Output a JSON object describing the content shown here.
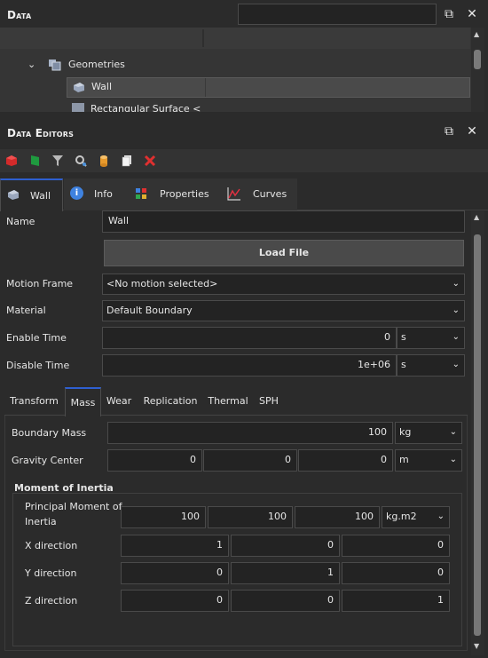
{
  "data_panel": {
    "title": "Data",
    "search_placeholder": "",
    "tree": [
      {
        "label": "Geometries",
        "expanded": true
      },
      {
        "label": "Wall",
        "selected": true
      },
      {
        "label": "Rectangular Surface <"
      }
    ]
  },
  "editors_panel": {
    "title": "Data Editors",
    "toolbar": [
      "red-cube-icon",
      "green-flag-icon",
      "filter-icon",
      "search-settings-icon",
      "cylinder-icon",
      "copy-icon",
      "delete-x-icon"
    ],
    "main_tabs": [
      {
        "label": "Wall",
        "icon": "wall-icon",
        "active": true
      },
      {
        "label": "Info",
        "icon": "info-icon"
      },
      {
        "label": "Properties",
        "icon": "properties-icon"
      },
      {
        "label": "Curves",
        "icon": "curves-icon"
      }
    ],
    "name_label": "Name",
    "name_value": "Wall",
    "load_file": "Load File",
    "motion_frame_label": "Motion Frame",
    "motion_frame_value": "<No motion selected>",
    "material_label": "Material",
    "material_value": "Default Boundary",
    "enable_time_label": "Enable Time",
    "enable_time_value": "0",
    "enable_time_unit": "s",
    "disable_time_label": "Disable Time",
    "disable_time_value": "1e+06",
    "disable_time_unit": "s",
    "sub_tabs": [
      "Transform",
      "Mass",
      "Wear",
      "Replication",
      "Thermal",
      "SPH"
    ],
    "active_sub_tab": "Mass",
    "boundary_mass_label": "Boundary Mass",
    "boundary_mass_value": "100",
    "boundary_mass_unit": "kg",
    "gravity_center_label": "Gravity Center",
    "gravity_center": [
      "0",
      "0",
      "0"
    ],
    "gravity_center_unit": "m",
    "moi_title": "Moment of Inertia",
    "principal_label_1": "Principal Moment of",
    "principal_label_2": "Inertia",
    "principal_values": [
      "100",
      "100",
      "100"
    ],
    "principal_unit": "kg.m2",
    "x_dir_label": "X direction",
    "x_dir": [
      "1",
      "0",
      "0"
    ],
    "y_dir_label": "Y direction",
    "y_dir": [
      "0",
      "1",
      "0"
    ],
    "z_dir_label": "Z direction",
    "z_dir": [
      "0",
      "0",
      "1"
    ]
  }
}
